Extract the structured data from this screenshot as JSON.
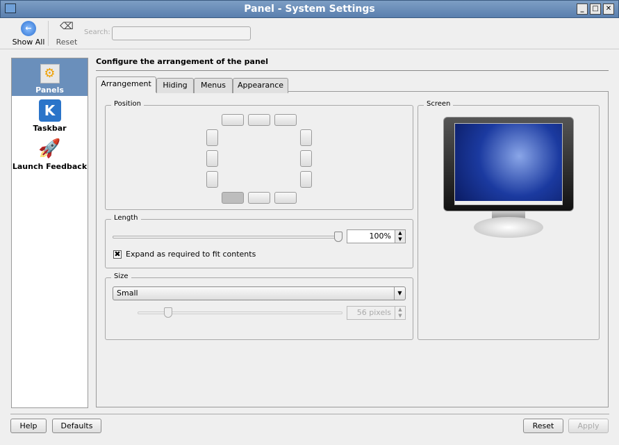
{
  "window": {
    "title": "Panel - System Settings",
    "min": "_",
    "max": "□",
    "close": "✕"
  },
  "toolbar": {
    "show_all": "Show All",
    "reset": "Reset",
    "search_label": "Search:",
    "search_value": ""
  },
  "sidebar": {
    "items": [
      {
        "label": "Panels",
        "selected": true
      },
      {
        "label": "Taskbar"
      },
      {
        "label": "Launch Feedback"
      }
    ]
  },
  "header": "Configure the arrangement of the panel",
  "tabs": [
    "Arrangement",
    "Hiding",
    "Menus",
    "Appearance"
  ],
  "position": {
    "label": "Position",
    "selected": "bottom-left"
  },
  "screen": {
    "label": "Screen"
  },
  "length": {
    "label": "Length",
    "value": "100%",
    "percent": 100,
    "expand_label": "Expand as required to fit contents",
    "expand_checked": true
  },
  "size": {
    "label": "Size",
    "selected": "Small",
    "pixels": "56 pixels",
    "slider_fraction": 0.15
  },
  "buttons": {
    "help": "Help",
    "defaults": "Defaults",
    "reset": "Reset",
    "apply": "Apply"
  }
}
